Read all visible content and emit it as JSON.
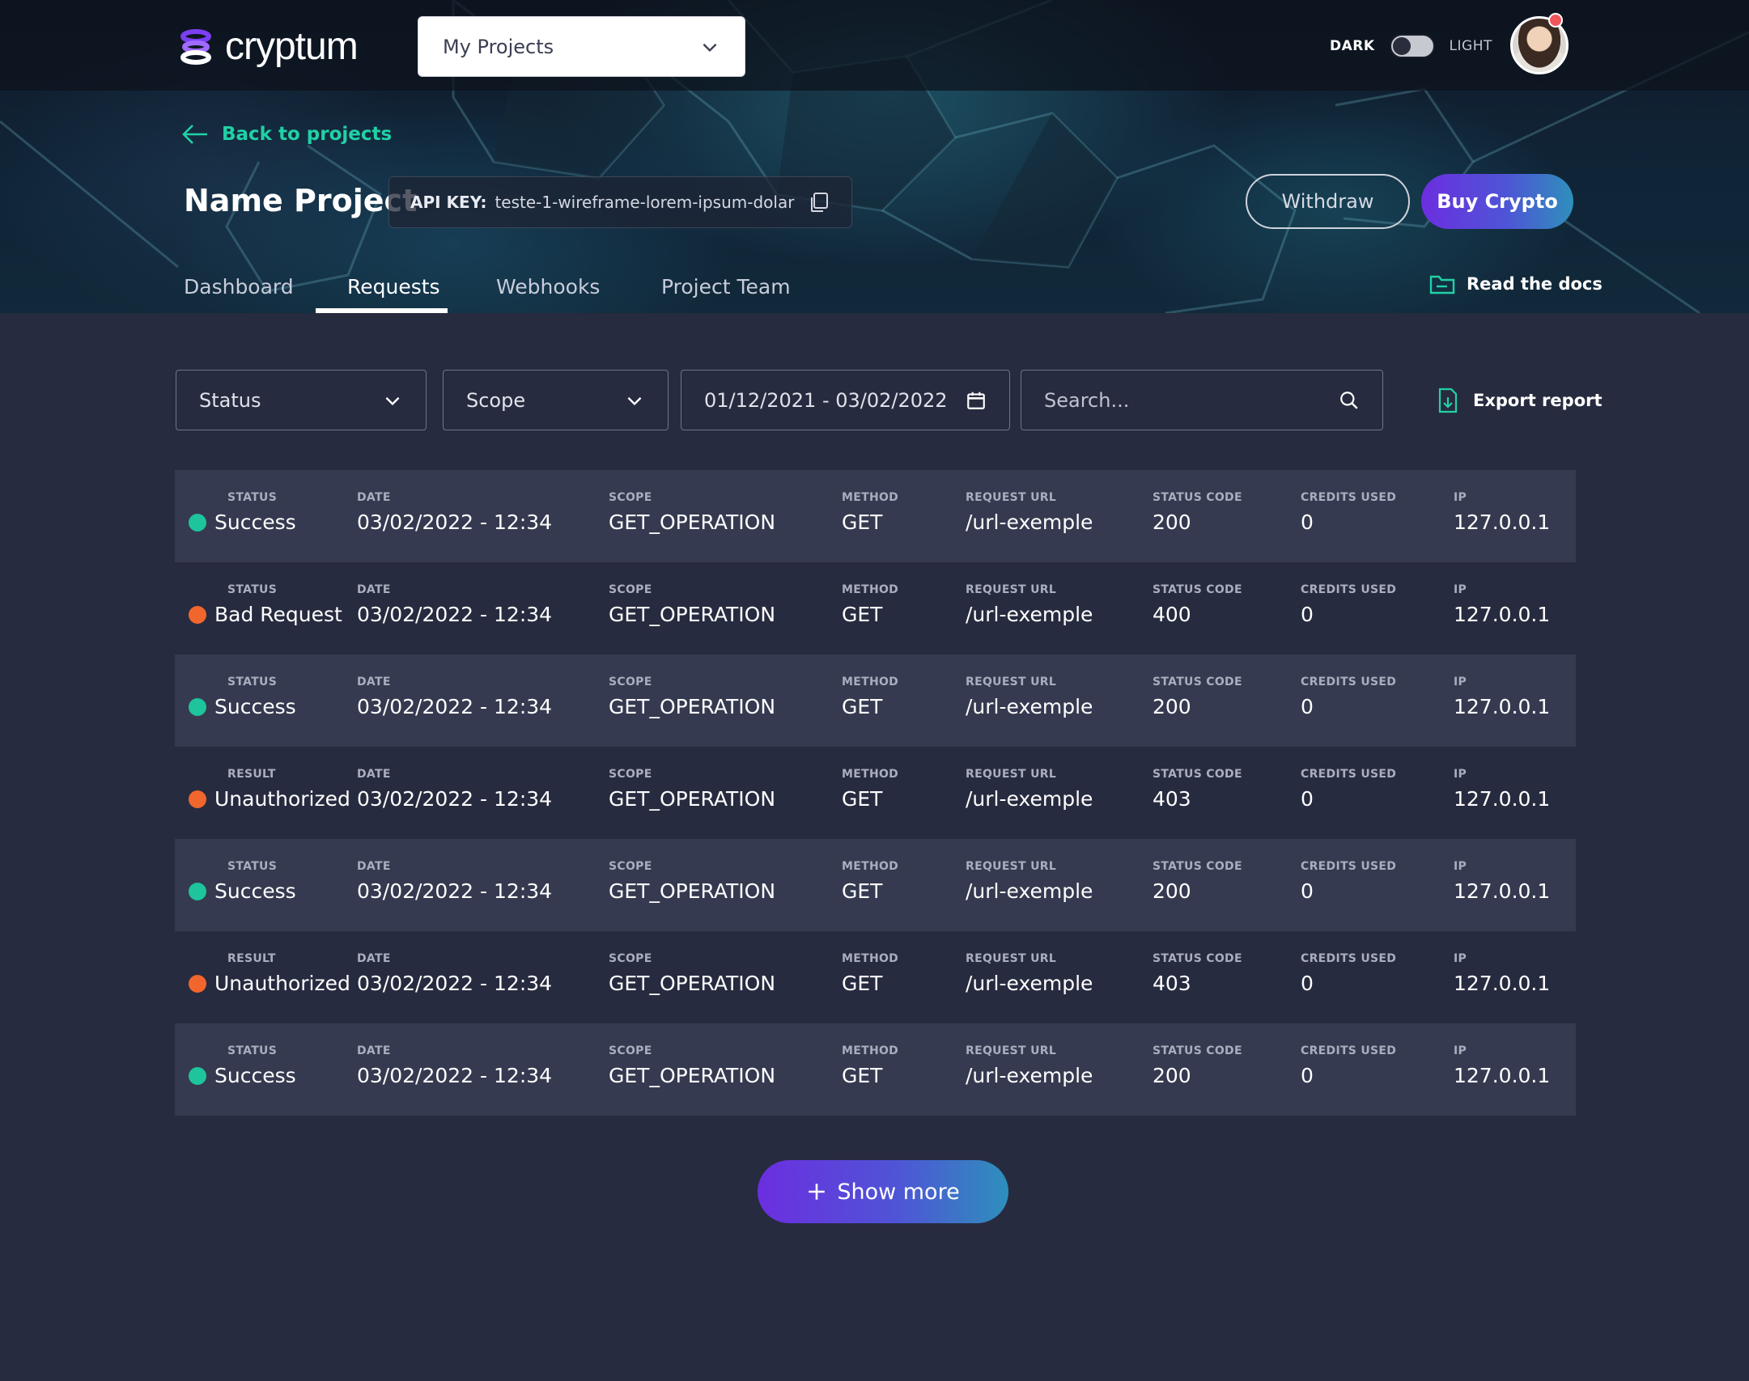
{
  "app": {
    "logo_text": "cryptum",
    "project_selector": "My Projects"
  },
  "theme": {
    "dark_label": "DARK",
    "light_label": "LIGHT"
  },
  "header": {
    "back_label": "Back to projects",
    "project_name": "Name Project",
    "api_key_label": "API KEY:",
    "api_key_value": "teste-1-wireframe-lorem-ipsum-dolar",
    "withdraw_label": "Withdraw",
    "buy_label": "Buy Crypto",
    "docs_label": "Read the docs"
  },
  "tabs": [
    {
      "label": "Dashboard",
      "active": false
    },
    {
      "label": "Requests",
      "active": true
    },
    {
      "label": "Webhooks",
      "active": false
    },
    {
      "label": "Project Team",
      "active": false
    }
  ],
  "filters": {
    "status": "Status",
    "scope": "Scope",
    "date_range": "01/12/2021 - 03/02/2022",
    "search_placeholder": "Search...",
    "export_label": "Export report"
  },
  "columns": {
    "date": "DATE",
    "scope": "SCOPE",
    "method": "METHOD",
    "url": "REQUEST URL",
    "code": "STATUS CODE",
    "credits": "CREDITS USED",
    "ip": "IP"
  },
  "rows": [
    {
      "status_label": "STATUS",
      "status": "Success",
      "kind": "ok",
      "date": "03/02/2022 - 12:34",
      "scope": "GET_OPERATION",
      "method": "GET",
      "url": "/url-exemple",
      "code": "200",
      "credits": "0",
      "ip": "127.0.0.1"
    },
    {
      "status_label": "STATUS",
      "status": "Bad Request",
      "kind": "err",
      "date": "03/02/2022 - 12:34",
      "scope": "GET_OPERATION",
      "method": "GET",
      "url": "/url-exemple",
      "code": "400",
      "credits": "0",
      "ip": "127.0.0.1"
    },
    {
      "status_label": "STATUS",
      "status": "Success",
      "kind": "ok",
      "date": "03/02/2022 - 12:34",
      "scope": "GET_OPERATION",
      "method": "GET",
      "url": "/url-exemple",
      "code": "200",
      "credits": "0",
      "ip": "127.0.0.1"
    },
    {
      "status_label": "RESULT",
      "status": "Unauthorized",
      "kind": "err",
      "date": "03/02/2022 - 12:34",
      "scope": "GET_OPERATION",
      "method": "GET",
      "url": "/url-exemple",
      "code": "403",
      "credits": "0",
      "ip": "127.0.0.1"
    },
    {
      "status_label": "STATUS",
      "status": "Success",
      "kind": "ok",
      "date": "03/02/2022 - 12:34",
      "scope": "GET_OPERATION",
      "method": "GET",
      "url": "/url-exemple",
      "code": "200",
      "credits": "0",
      "ip": "127.0.0.1"
    },
    {
      "status_label": "RESULT",
      "status": "Unauthorized",
      "kind": "err",
      "date": "03/02/2022 - 12:34",
      "scope": "GET_OPERATION",
      "method": "GET",
      "url": "/url-exemple",
      "code": "403",
      "credits": "0",
      "ip": "127.0.0.1"
    },
    {
      "status_label": "STATUS",
      "status": "Success",
      "kind": "ok",
      "date": "03/02/2022 - 12:34",
      "scope": "GET_OPERATION",
      "method": "GET",
      "url": "/url-exemple",
      "code": "200",
      "credits": "0",
      "ip": "127.0.0.1"
    }
  ],
  "show_more_label": "Show more",
  "colors": {
    "success": "#1ec49b",
    "error": "#f0662c",
    "accent": "#21d1a6",
    "gradient_start": "#6c2ee0",
    "gradient_end": "#2e8fbc",
    "background": "#272b3f"
  },
  "icons": {
    "logo": "cryptum-logo-icon",
    "dropdown": "chevron-down-icon",
    "back": "arrow-left-icon",
    "copy": "copy-icon",
    "docs": "folder-icon",
    "calendar": "calendar-icon",
    "search": "search-icon",
    "export": "file-download-icon",
    "add": "plus-icon"
  }
}
